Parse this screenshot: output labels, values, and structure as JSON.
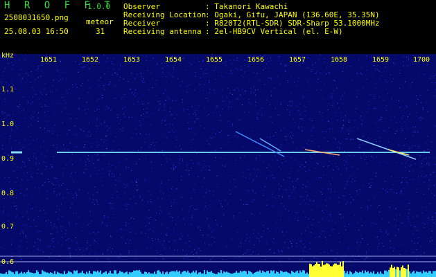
{
  "header": {
    "app_title": "H R O F F T",
    "app_version": "1.0.0",
    "filename": "2508031650.png",
    "datetime": "25.08.03 16:50",
    "meteor_label": "meteor",
    "meteor_count": "31",
    "info": [
      {
        "key": "Observer",
        "value": ": Takanori Kawachi"
      },
      {
        "key": "Receiving Location",
        "value": ": Ogaki, Gifu, JAPAN (136.60E, 35.35N)"
      },
      {
        "key": "Receiver",
        "value": ": R820T2(RTL-SDR) SDR-Sharp 53.1000MHz"
      },
      {
        "key": "Receiving antenna",
        "value": ": 2el-HB9CV Vertical (el. E-W)"
      }
    ]
  },
  "axis": {
    "y_unit": "kHz",
    "y_ticks": [
      "1.1",
      "1.0",
      "0.9",
      "0.8",
      "0.7",
      "0.6"
    ],
    "x_ticks": [
      "1651",
      "1652",
      "1653",
      "1654",
      "1655",
      "1656",
      "1657",
      "1658",
      "1659",
      "1700"
    ]
  },
  "colors": {
    "background": "#000000",
    "noise": "#0a0f8a",
    "trace": "#66ccff",
    "label": "#ffff00",
    "title": "#33dd33"
  }
}
